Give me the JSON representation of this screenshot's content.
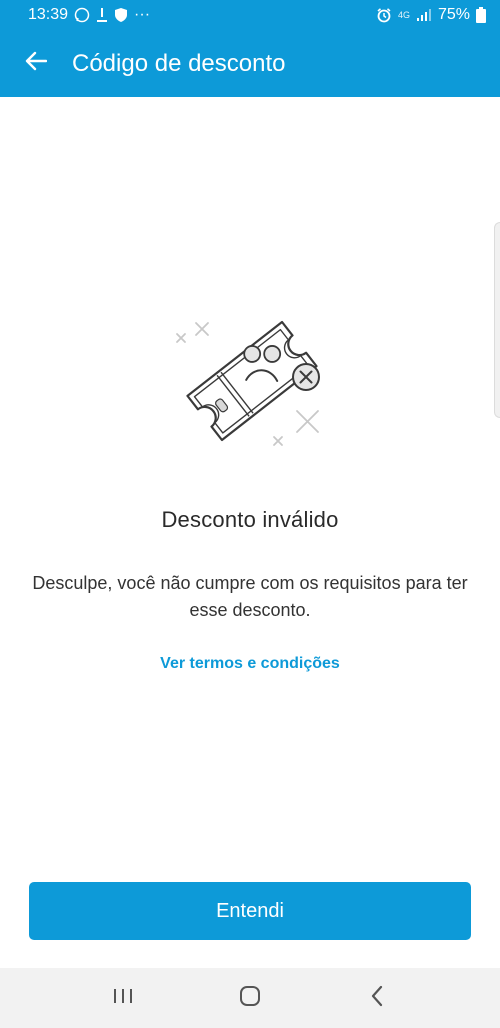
{
  "status_bar": {
    "time": "13:39",
    "dots": "···",
    "network": "4G",
    "battery": "75%"
  },
  "header": {
    "title": "Código de desconto",
    "back_icon": "arrow-left-icon"
  },
  "illustration": {
    "icon": "invalid-coupon-icon"
  },
  "message": {
    "title": "Desconto inválido",
    "body": "Desculpe, você não cumpre com os requisitos para ter esse desconto.",
    "link": "Ver termos e condições"
  },
  "actions": {
    "primary_label": "Entendi"
  },
  "nav_bar": {
    "recents_icon": "recent-apps-icon",
    "home_icon": "home-icon",
    "back_icon": "back-chevron-icon"
  },
  "colors": {
    "brand": "#0d9ad8",
    "text": "#333333",
    "nav": "#f2f2f2"
  }
}
